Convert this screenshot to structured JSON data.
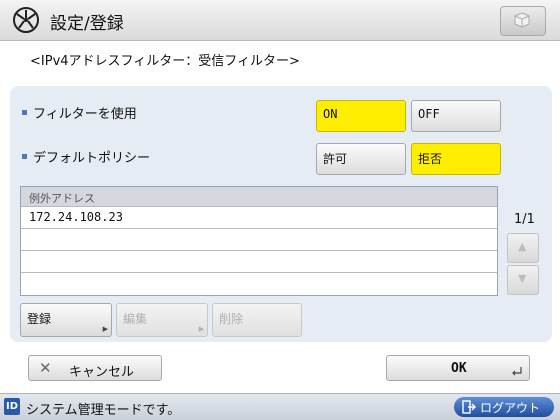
{
  "header": {
    "title": "設定/登録",
    "icon": "settings-register-icon",
    "right_button_icon": "box-icon"
  },
  "subtitle": "<IPv4アドレスフィルター：受信フィルター>",
  "filter_use": {
    "label": "フィルターを使用",
    "options": [
      "ON",
      "OFF"
    ],
    "selected": "ON"
  },
  "default_policy": {
    "label": "デフォルトポリシー",
    "options": [
      "許可",
      "拒否"
    ],
    "selected": "拒否"
  },
  "exception_list": {
    "header": "例外アドレス",
    "rows": [
      "172.24.108.23",
      "",
      "",
      ""
    ],
    "page": "1/1"
  },
  "list_actions": {
    "register": "登録",
    "edit": "編集",
    "delete": "削除"
  },
  "footer": {
    "cancel": "キャンセル",
    "ok": "OK"
  },
  "status": {
    "id_badge": "ID",
    "message": "システム管理モードです。",
    "logout": "ログアウト"
  },
  "colors": {
    "selected": "#ffee00",
    "panel": "#e6ecf3",
    "logout": "#2a59a8"
  }
}
